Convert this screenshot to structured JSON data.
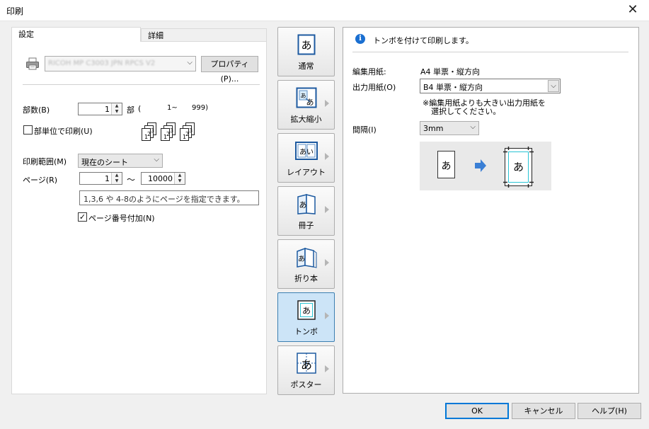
{
  "window": {
    "title": "印刷",
    "close_glyph": "✕"
  },
  "tabs": [
    {
      "label": "設定",
      "active": true
    },
    {
      "label": "詳細",
      "active": false
    }
  ],
  "printer": {
    "icon": "printer-icon",
    "name": "RICOH MP C3003 JPN RPCS V2",
    "properties_button": "プロパティ(P)..."
  },
  "copies": {
    "label": "部数(B)",
    "value": "1",
    "unit": "部",
    "range_open": "(",
    "range_from": "1~",
    "range_to": "999)"
  },
  "collate": {
    "label": "部単位で印刷(U)",
    "checked": false,
    "page_nums": [
      "1",
      "2",
      "3"
    ]
  },
  "print_range": {
    "label": "印刷範囲(M)",
    "selected": "現在のシート"
  },
  "pages": {
    "label": "ページ(R)",
    "from": "1",
    "separator": "～",
    "to": "10000",
    "hint": "1,3,6 や 4-8のようにページを指定できます。"
  },
  "page_number": {
    "label": "ページ番号付加(N)",
    "checked": true
  },
  "modes": [
    {
      "label": "通常",
      "icon": "normal-icon",
      "active": false,
      "has_arrow": false
    },
    {
      "label": "拡大縮小",
      "icon": "scale-icon",
      "active": false,
      "has_arrow": true
    },
    {
      "label": "レイアウト",
      "icon": "layout-icon",
      "active": false,
      "has_arrow": true
    },
    {
      "label": "冊子",
      "icon": "booklet-icon",
      "active": false,
      "has_arrow": true
    },
    {
      "label": "折り本",
      "icon": "folded-book-icon",
      "active": false,
      "has_arrow": true
    },
    {
      "label": "トンボ",
      "icon": "crop-marks-icon",
      "active": true,
      "has_arrow": true
    },
    {
      "label": "ポスター",
      "icon": "poster-icon",
      "active": false,
      "has_arrow": true
    }
  ],
  "mode_glyph": "あ",
  "mode_glyph_layout": "あい",
  "right": {
    "info_text": "トンボを付けて印刷します。",
    "edit_paper_label": "編集用紙:",
    "edit_paper_value": "A4 単票・縦方向",
    "output_paper_label": "出力用紙(O)",
    "output_paper_value": "B4 単票・縦方向",
    "note_line1": "※編集用紙よりも大きい出力用紙を",
    "note_line2": "選択してください。",
    "spacing_label": "間隔(I)",
    "spacing_value": "3mm"
  },
  "footer": {
    "ok": "OK",
    "cancel": "キャンセル",
    "help": "ヘルプ(H)"
  },
  "colors": {
    "accent": "#0078d7",
    "active_mode_bg": "#cce4f7",
    "arrow_blue": "#3a7fd5",
    "crop_cyan": "#29c4d4"
  }
}
